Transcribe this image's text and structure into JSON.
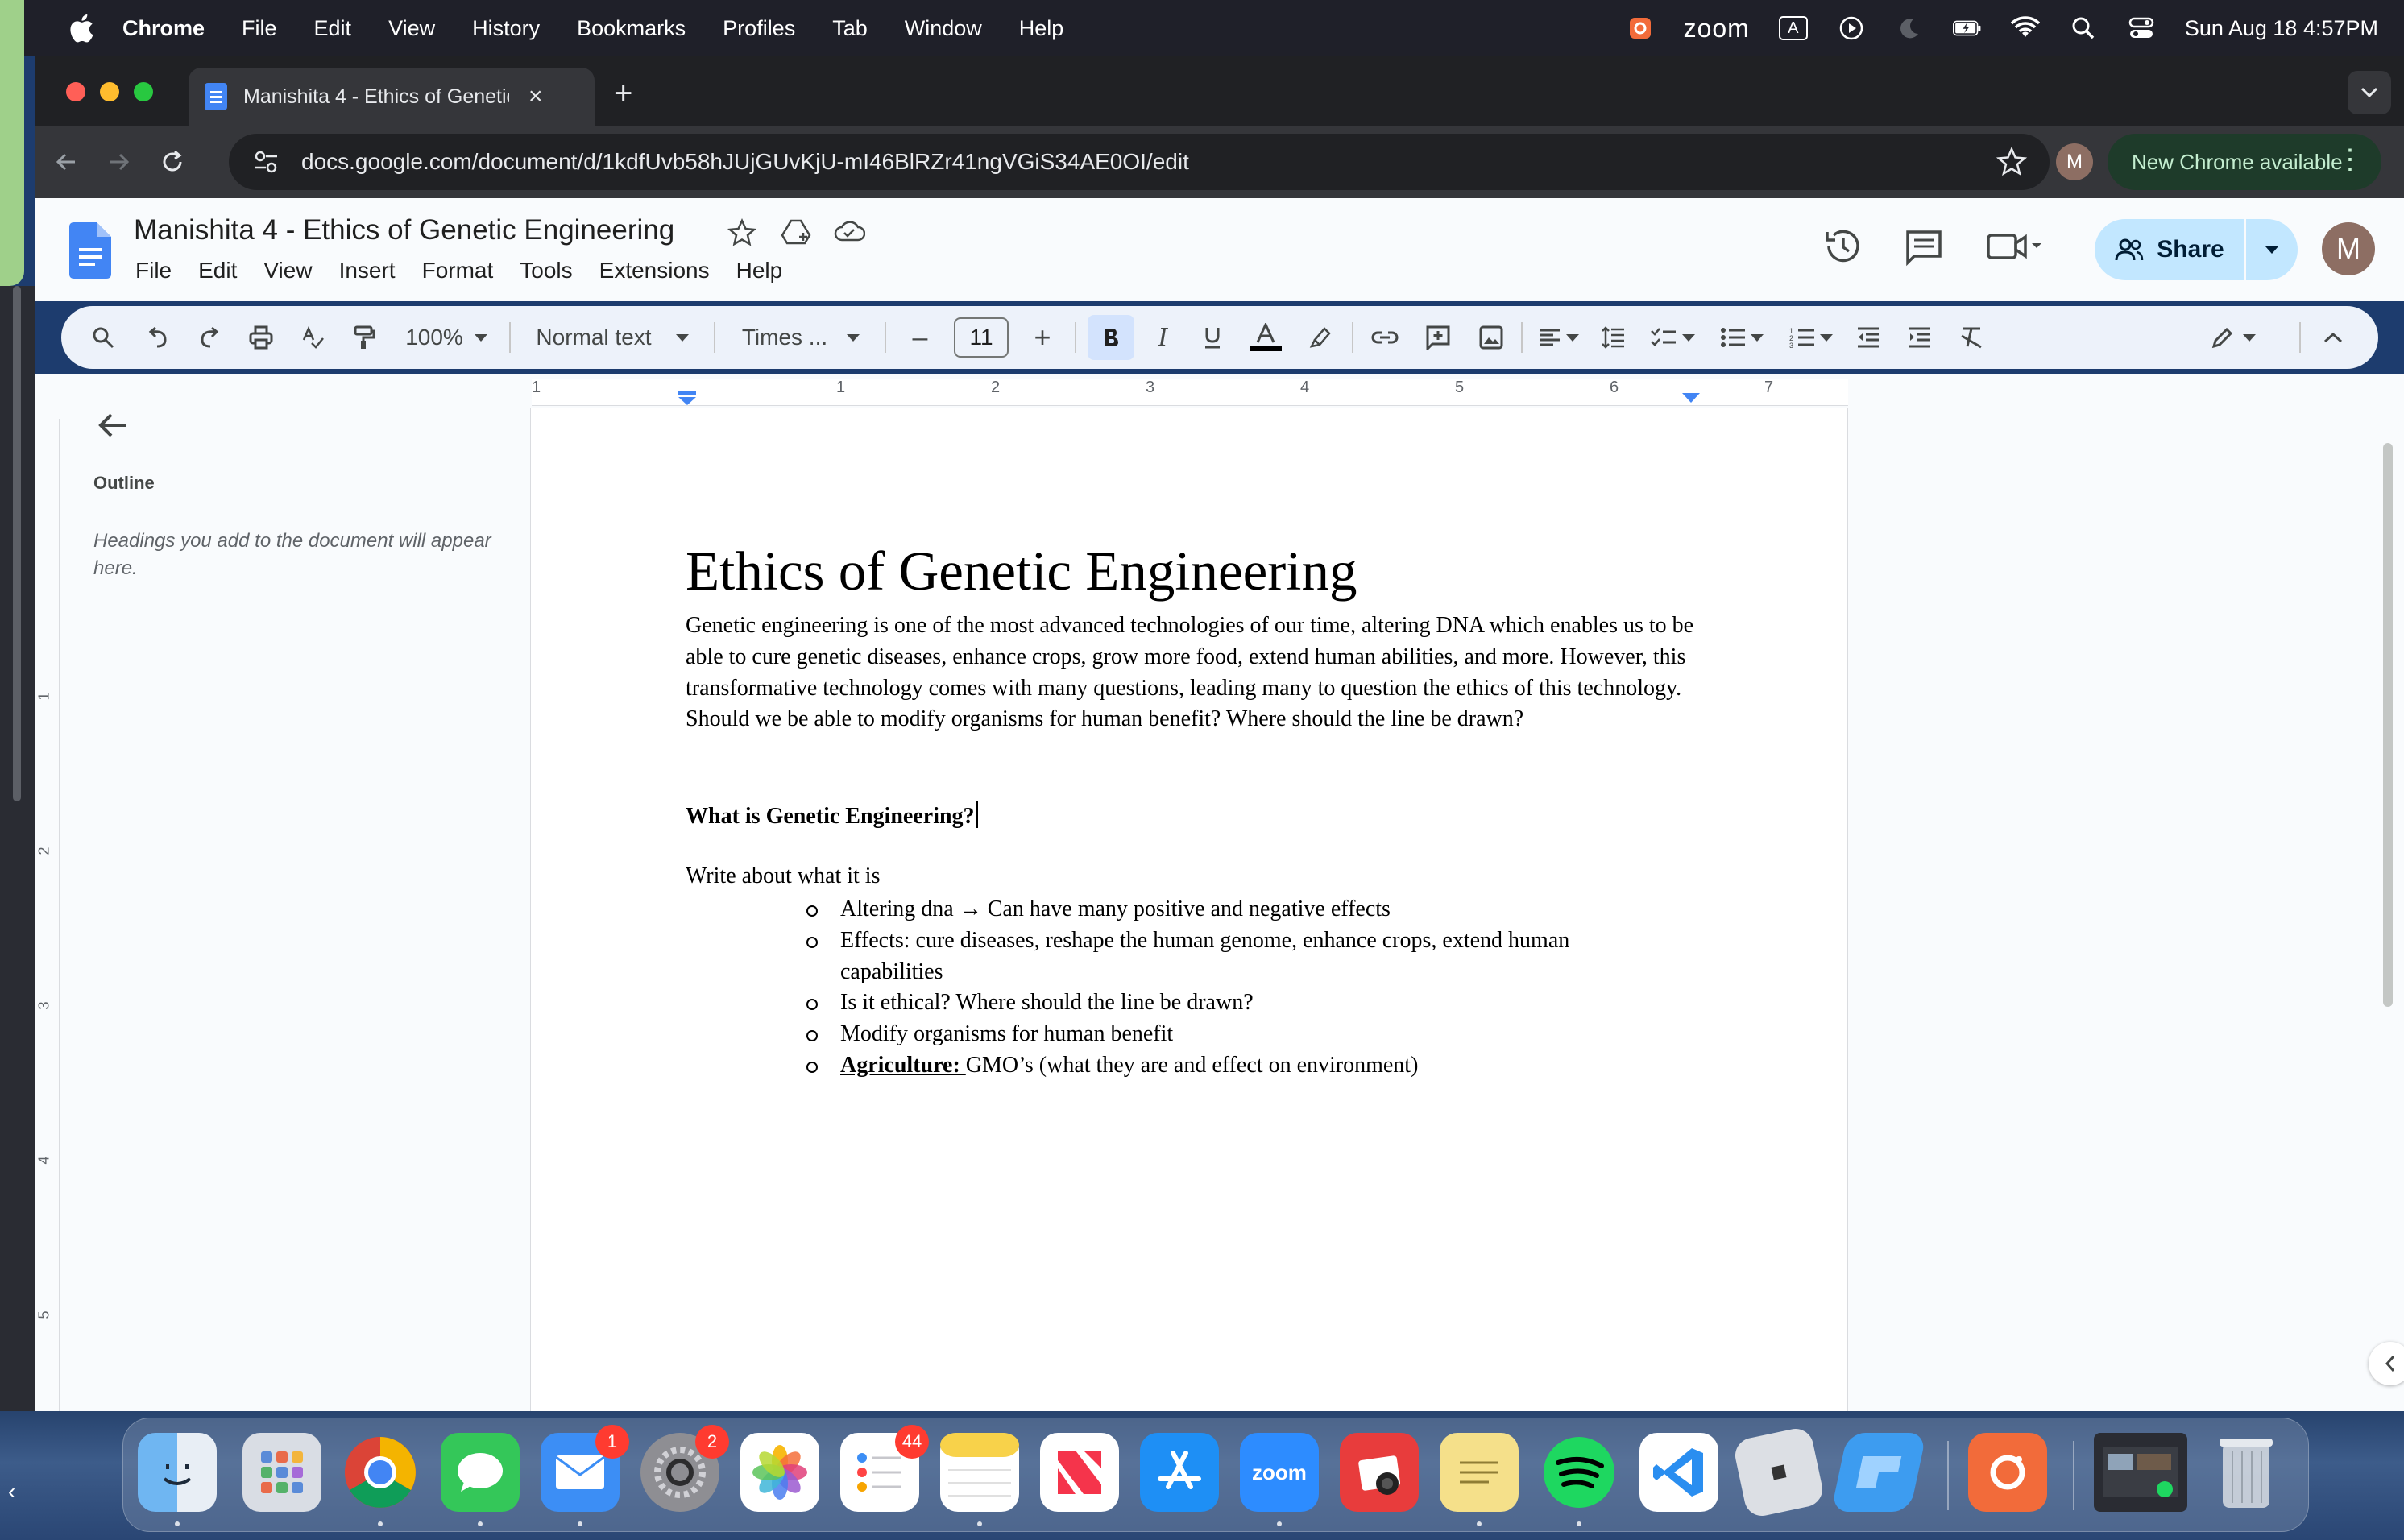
{
  "menubar": {
    "app": "Chrome",
    "items": [
      "File",
      "Edit",
      "View",
      "History",
      "Bookmarks",
      "Profiles",
      "Tab",
      "Window",
      "Help"
    ],
    "zoom_label": "zoom",
    "input_source": "A",
    "datetime": "Sun Aug 18  4:57PM"
  },
  "browser": {
    "tab_title": "Manishita 4 - Ethics of Genetic Engineering",
    "tab_close": "×",
    "new_tab": "+",
    "url": "docs.google.com/document/d/1kdfUvb58hJUjGUvKjU-mI46BlRZr41ngVGiS34AE0OI/edit",
    "profile_initial": "M",
    "new_chrome": "New Chrome available"
  },
  "docs": {
    "title": "Manishita 4 - Ethics of Genetic Engineering",
    "menu": [
      "File",
      "Edit",
      "View",
      "Insert",
      "Format",
      "Tools",
      "Extensions",
      "Help"
    ],
    "share_label": "Share",
    "avatar_initial": "M"
  },
  "toolbar": {
    "zoom": "100%",
    "style": "Normal text",
    "font": "Times ...",
    "font_size": "11",
    "minus": "–",
    "plus": "+"
  },
  "outline": {
    "title": "Outline",
    "hint": "Headings you add to the document will appear here."
  },
  "ruler": {
    "horizontal": [
      "1",
      "1",
      "2",
      "3",
      "4",
      "5",
      "6",
      "7"
    ],
    "vertical": [
      "1",
      "2",
      "3",
      "4",
      "5"
    ]
  },
  "document": {
    "heading": "Ethics of Genetic Engineering",
    "intro": "Genetic engineering is one of the most advanced technologies of our time, altering DNA which enables us to be able to cure genetic diseases, enhance crops, grow more food, extend human abilities, and more. However, this transformative technology comes with many questions, leading many to question the ethics of this technology. Should we be able to modify organisms for human benefit? Where should the line be drawn?",
    "subheading": "What is Genetic Engineering?",
    "write_line": "Write about what it is",
    "bullets": [
      "Altering dna → Can have many positive and negative effects",
      "Effects: cure diseases, reshape the human genome, enhance crops, extend human capabilities",
      "Is it ethical? Where should the line be drawn?",
      "Modify organisms for human benefit"
    ],
    "last_bullet_bold": "Agriculture: ",
    "last_bullet_rest": "GMO’s  (what they are and effect on environment)"
  },
  "dock": {
    "zoom_label": "zoom",
    "mail_badge": "1",
    "settings_badge": "2",
    "reminders_badge": "44"
  },
  "colors": {
    "docs_blue": "#4285f4",
    "share_bg": "#c2e7ff",
    "toolbar_bg": "#edf2fa",
    "new_chrome_bg": "#1e3b2a"
  }
}
